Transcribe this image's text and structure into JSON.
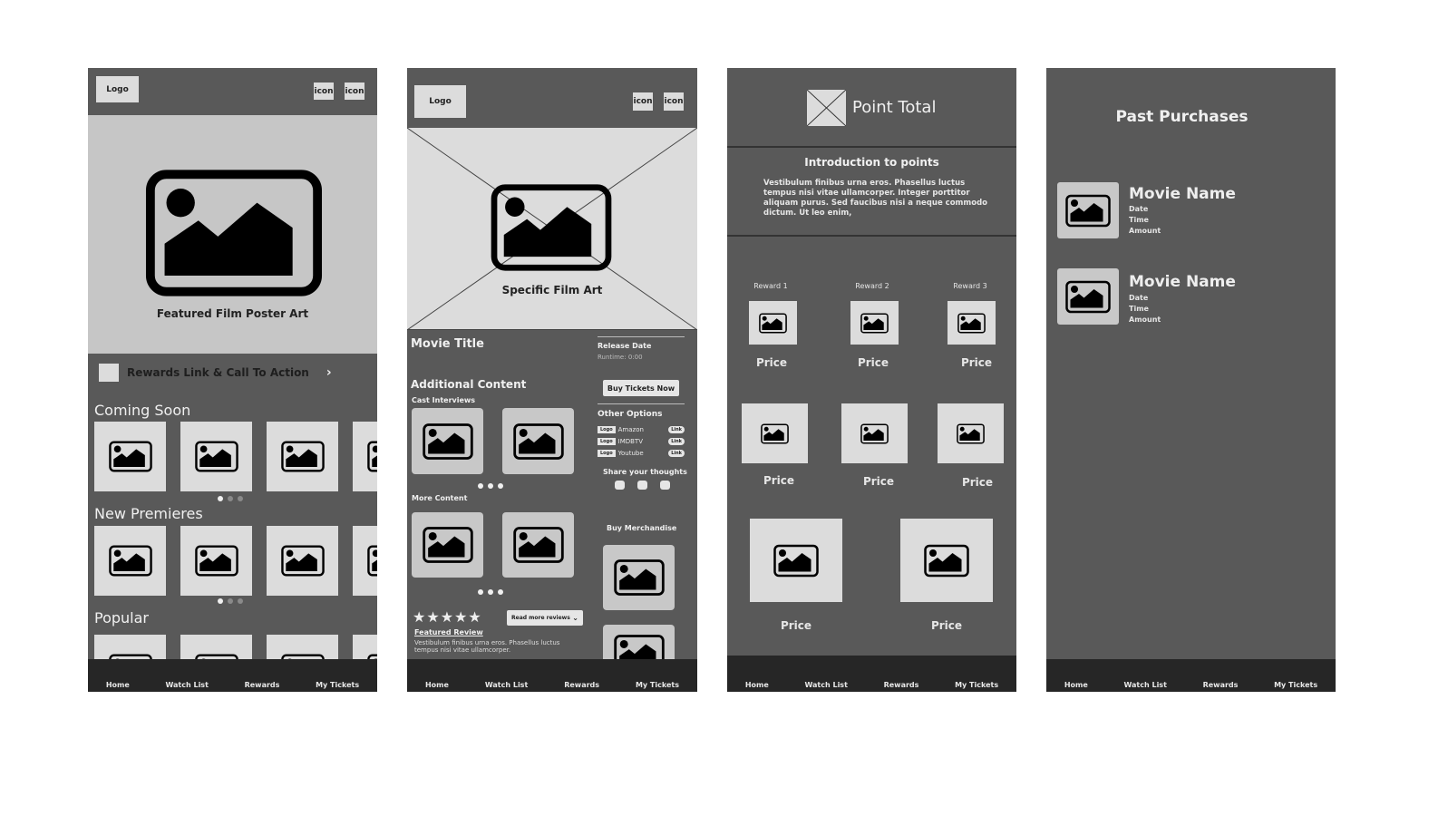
{
  "nav": [
    "Home",
    "Watch List",
    "Rewards",
    "My Tickets"
  ],
  "home_screen": {
    "logo": "Logo",
    "icons": [
      "icon",
      "icon"
    ],
    "hero_caption": "Featured Film Poster Art",
    "rewards_cta": "Rewards Link & Call To Action",
    "sections": [
      {
        "title": "Coming Soon",
        "page_dots": 3,
        "active_dot": 1
      },
      {
        "title": "New Premieres",
        "page_dots": 3,
        "active_dot": 1
      },
      {
        "title": "Popular"
      }
    ]
  },
  "film_screen": {
    "logo": "Logo",
    "icons": [
      "icon",
      "icon"
    ],
    "hero_caption": "Specific Film Art",
    "movie_title": "Movie Title",
    "release_date": "Release Date",
    "runtime": "Runtime: 0:00",
    "buy_tickets": "Buy Tickets Now",
    "additional_content": "Additional Content",
    "cast_interviews": "Cast Interviews",
    "more_content": "More Content",
    "other_options": {
      "title": "Other Options",
      "items": [
        {
          "logo": "Logo",
          "name": "Amazon",
          "link": "Link"
        },
        {
          "logo": "Logo",
          "name": "IMDBTV",
          "link": "Link"
        },
        {
          "logo": "Logo",
          "name": "Youtube",
          "link": "Link"
        }
      ]
    },
    "share_thoughts": "Share your thoughts",
    "buy_merchandise": "Buy Merchandise",
    "rating_stars": 5,
    "stars_text": "★★★★★",
    "read_more": "Read more reviews",
    "featured_review_title": "Featured Review",
    "featured_review_text": "Vestibulum finibus urna eros. Phasellus luctus tempus nisi vitae ullamcorper."
  },
  "rewards_screen": {
    "point_total": "Point Total",
    "intro_title": "Introduction to points",
    "intro_text": "Vestibulum finibus urna eros. Phasellus luctus tempus nisi vitae ullamcorper. Integer porttitor aliquam purus. Sed faucibus nisi a neque commodo dictum. Ut leo enim,",
    "rewards": [
      "Reward 1",
      "Reward 2",
      "Reward 3"
    ],
    "price_label": "Price"
  },
  "purchases_screen": {
    "title": "Past Purchases",
    "items": [
      {
        "name": "Movie Name",
        "date": "Date",
        "time": "Time",
        "amount": "Amount"
      },
      {
        "name": "Movie Name",
        "date": "Date",
        "time": "Time",
        "amount": "Amount"
      }
    ]
  },
  "colors": {
    "screen_bg": "#595959",
    "navbar_bg": "#262626",
    "placeholder_light": "#dcdcdc",
    "hero_bg": "#c6c6c6"
  }
}
